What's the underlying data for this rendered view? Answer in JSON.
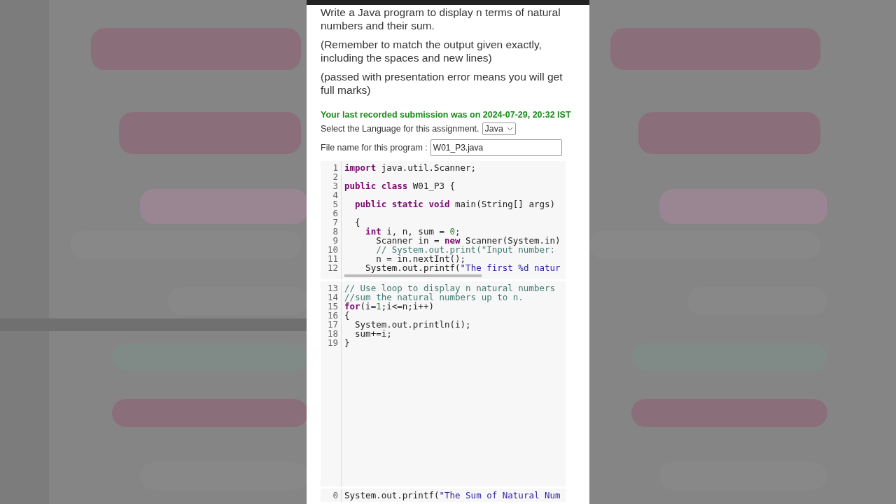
{
  "question": {
    "paragraphs": [
      "Write a Java program to display n terms of natural numbers and their sum.",
      "(Remember to match the output given exactly, including the spaces and new lines)",
      "(passed with presentation error means you will get full marks)"
    ]
  },
  "submission_note": "Your last recorded submission was on 2024-07-29, 20:32 IST",
  "language": {
    "label": "Select the Language for this assignment.",
    "value": "Java"
  },
  "file_name": {
    "label": "File name for this program :",
    "value": "W01_P3.java"
  },
  "editor": {
    "blocks": [
      {
        "lines": [
          {
            "number": "1",
            "tokens": [
              {
                "kind": "keyword",
                "text": "import"
              },
              {
                "kind": "plain",
                "text": " java.util.Scanner;"
              }
            ]
          },
          {
            "number": "2"
          },
          {
            "number": "3",
            "tokens": [
              {
                "kind": "keyword",
                "text": "public class"
              },
              {
                "kind": "plain",
                "text": " W01_P3 {"
              }
            ]
          },
          {
            "number": "4"
          },
          {
            "number": "5",
            "tokens": [
              {
                "kind": "keyword",
                "text": "  public static void"
              },
              {
                "kind": "plain",
                "text": " main(String[] args)"
              }
            ]
          },
          {
            "number": "6"
          },
          {
            "number": "7",
            "tokens": [
              {
                "kind": "plain",
                "text": "  {"
              }
            ]
          },
          {
            "number": "8",
            "tokens": [
              {
                "kind": "keyword",
                "text": "    int"
              },
              {
                "kind": "plain",
                "text": " i, n, sum = "
              },
              {
                "kind": "number",
                "text": "0"
              },
              {
                "kind": "plain",
                "text": ";"
              }
            ]
          },
          {
            "number": "9",
            "tokens": [
              {
                "kind": "plain",
                "text": "      Scanner in = "
              },
              {
                "kind": "keyword",
                "text": "new"
              },
              {
                "kind": "plain",
                "text": " Scanner(System.in)"
              }
            ]
          },
          {
            "number": "10",
            "tokens": [
              {
                "kind": "comment",
                "text": "      // System.out.print(\"Input number:"
              }
            ]
          },
          {
            "number": "11",
            "tokens": [
              {
                "kind": "plain",
                "text": "      n = in.nextInt();"
              }
            ]
          },
          {
            "number": "12",
            "tokens": [
              {
                "kind": "plain",
                "text": "    System.out.printf("
              },
              {
                "kind": "string",
                "text": "\"The first %d natur"
              }
            ]
          }
        ],
        "scrollbar": true
      },
      {
        "lines": [
          {
            "number": "13",
            "tokens": [
              {
                "kind": "comment",
                "text": "// Use loop to display n natural numbers"
              }
            ]
          },
          {
            "number": "14",
            "tokens": [
              {
                "kind": "comment",
                "text": "//sum the natural numbers up to n."
              }
            ]
          },
          {
            "number": "15",
            "tokens": [
              {
                "kind": "keyword",
                "text": "for"
              },
              {
                "kind": "plain",
                "text": "(i="
              },
              {
                "kind": "number",
                "text": "1"
              },
              {
                "kind": "plain",
                "text": ";i<=n;i++)"
              }
            ]
          },
          {
            "number": "16",
            "tokens": [
              {
                "kind": "plain",
                "text": "{"
              }
            ]
          },
          {
            "number": "17",
            "tokens": [
              {
                "kind": "plain",
                "text": "  System.out.println(i);"
              }
            ]
          },
          {
            "number": "18",
            "tokens": [
              {
                "kind": "plain",
                "text": "  sum+=i;"
              }
            ]
          },
          {
            "number": "19",
            "tokens": [
              {
                "kind": "plain",
                "text": "}"
              }
            ]
          }
        ]
      },
      {
        "lines": [
          {
            "number": "0",
            "tokens": [
              {
                "kind": "plain",
                "text": "System.out.printf("
              },
              {
                "kind": "string",
                "text": "\"The Sum of Natural Num"
              }
            ]
          }
        ]
      }
    ]
  }
}
